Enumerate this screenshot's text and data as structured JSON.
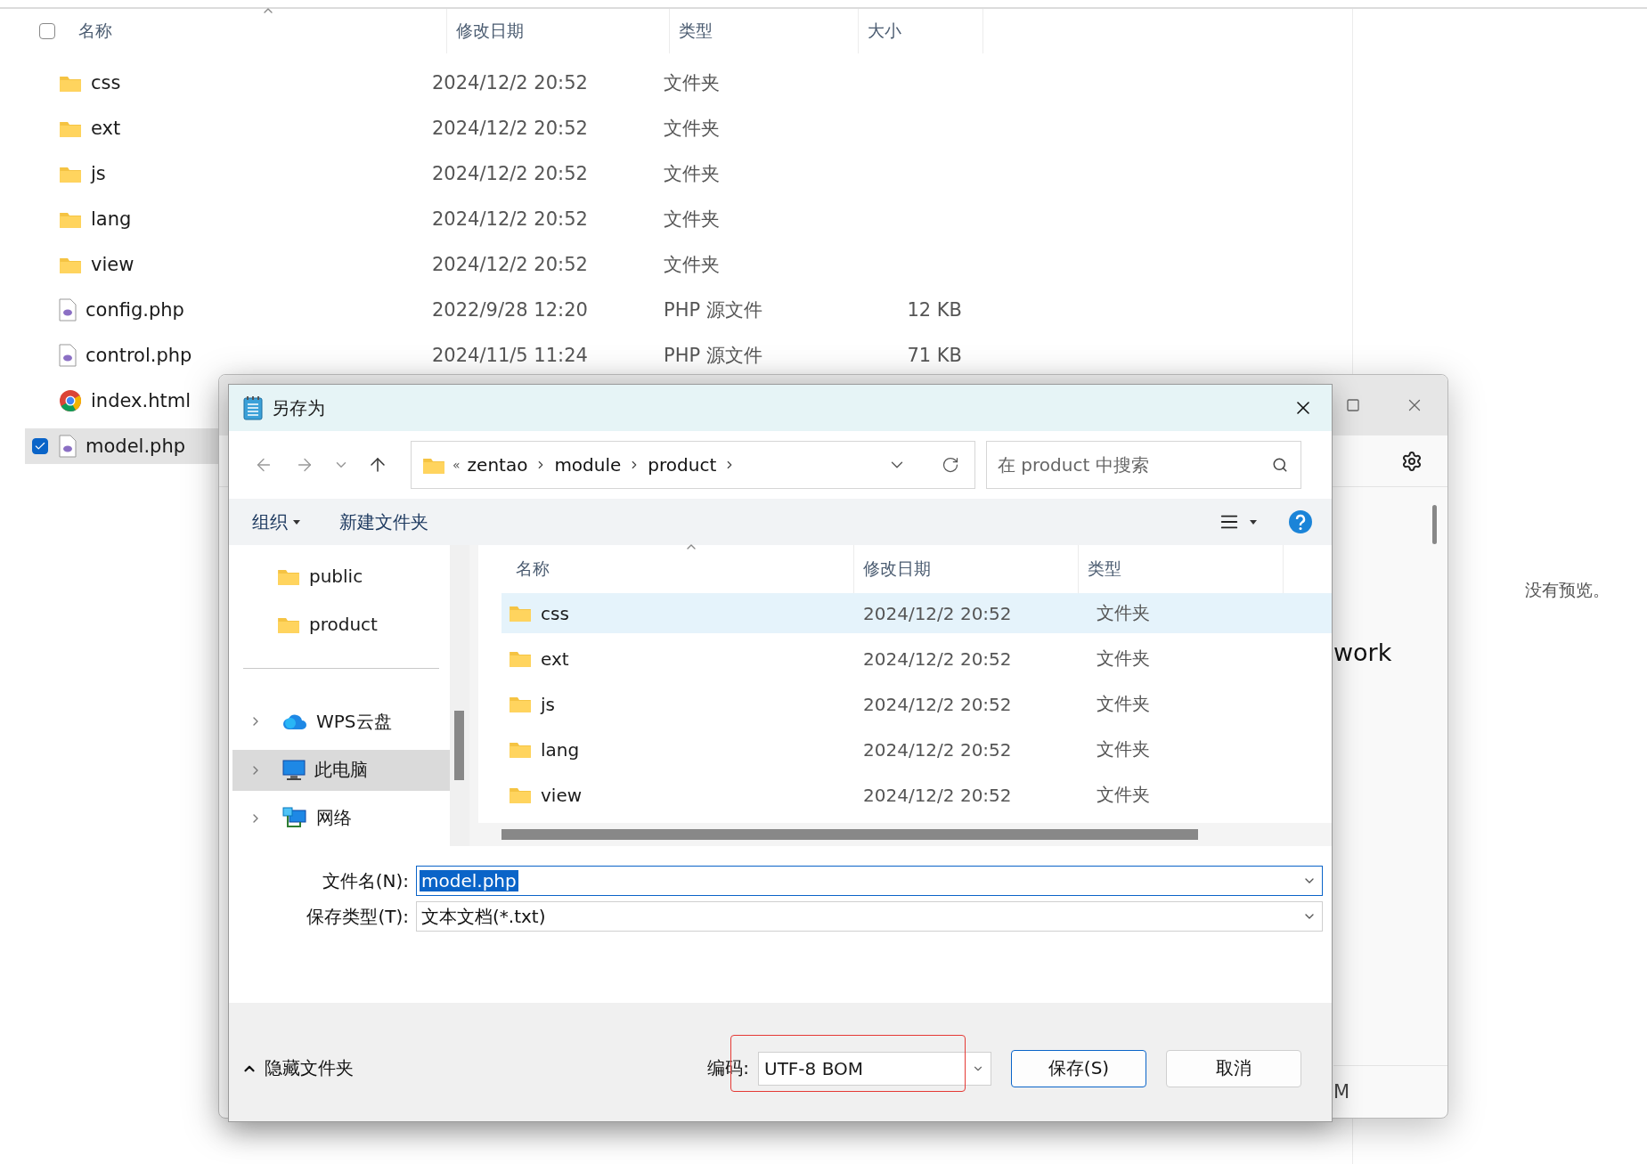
{
  "explorer": {
    "select_all": {
      "checked": false
    },
    "columns": [
      {
        "label": "名称",
        "sorted": true
      },
      {
        "label": "修改日期",
        "sorted": false
      },
      {
        "label": "类型",
        "sorted": false
      },
      {
        "label": "大小",
        "sorted": false
      }
    ],
    "rows": [
      {
        "name": "css",
        "kind": "folder",
        "date": "2024/12/2 20:52",
        "type": "文件夹",
        "selected": false,
        "checked": false
      },
      {
        "name": "ext",
        "kind": "folder",
        "date": "2024/12/2 20:52",
        "type": "文件夹",
        "selected": false,
        "checked": false
      },
      {
        "name": "js",
        "kind": "folder",
        "date": "2024/12/2 20:52",
        "type": "文件夹",
        "selected": false,
        "checked": false
      },
      {
        "name": "lang",
        "kind": "folder",
        "date": "2024/12/2 20:52",
        "type": "文件夹",
        "selected": false,
        "checked": false
      },
      {
        "name": "view",
        "kind": "folder",
        "date": "2024/12/2 20:52",
        "type": "文件夹",
        "selected": false,
        "checked": false
      },
      {
        "name": "config.php",
        "kind": "php",
        "date": "2022/9/28 12:20",
        "type": "PHP 源文件",
        "size": "12 KB",
        "selected": false,
        "checked": false
      },
      {
        "name": "control.php",
        "kind": "php",
        "date": "2024/11/5 11:24",
        "type": "PHP 源文件",
        "size": "71 KB",
        "selected": false,
        "checked": false
      },
      {
        "name": "index.html",
        "kind": "browser",
        "selected": false,
        "checked": false
      },
      {
        "name": "model.php",
        "kind": "php",
        "selected": true,
        "checked": true
      }
    ],
    "preview_text": "没有预览。"
  },
  "background_window": {
    "text": "work",
    "status_text": "M"
  },
  "dialog": {
    "title": "另存为",
    "address": {
      "overflow": "«",
      "crumbs": [
        "zentao",
        "module",
        "product"
      ]
    },
    "search": {
      "placeholder": "在 product 中搜索"
    },
    "toolbar": {
      "organize": "组织",
      "new_folder": "新建文件夹"
    },
    "nav": [
      {
        "label": "public",
        "kind": "folder",
        "selected": false,
        "expandable": false
      },
      {
        "label": "product",
        "kind": "folder",
        "selected": false,
        "expandable": false
      },
      {
        "label": "WPS云盘",
        "kind": "cloud",
        "selected": false,
        "expandable": true
      },
      {
        "label": "此电脑",
        "kind": "computer",
        "selected": true,
        "expandable": true
      },
      {
        "label": "网络",
        "kind": "network",
        "selected": false,
        "expandable": true
      }
    ],
    "columns": [
      {
        "label": "名称",
        "sorted": true
      },
      {
        "label": "修改日期",
        "sorted": false
      },
      {
        "label": "类型",
        "sorted": false
      }
    ],
    "rows": [
      {
        "name": "css",
        "date": "2024/12/2 20:52",
        "type": "文件夹",
        "selected": true
      },
      {
        "name": "ext",
        "date": "2024/12/2 20:52",
        "type": "文件夹",
        "selected": false
      },
      {
        "name": "js",
        "date": "2024/12/2 20:52",
        "type": "文件夹",
        "selected": false
      },
      {
        "name": "lang",
        "date": "2024/12/2 20:52",
        "type": "文件夹",
        "selected": false
      },
      {
        "name": "view",
        "date": "2024/12/2 20:52",
        "type": "文件夹",
        "selected": false
      }
    ],
    "file_name": {
      "label": "文件名(N):",
      "value": "model.php",
      "text_selected": true
    },
    "file_type": {
      "label": "保存类型(T):",
      "value": "文本文档(*.txt)"
    },
    "hide_folders": "隐藏文件夹",
    "encoding": {
      "label": "编码:",
      "value": "UTF-8 BOM",
      "highlighted": true
    },
    "buttons": [
      {
        "label": "保存(S)",
        "kind": "primary"
      },
      {
        "label": "取消",
        "kind": "secondary"
      }
    ]
  }
}
